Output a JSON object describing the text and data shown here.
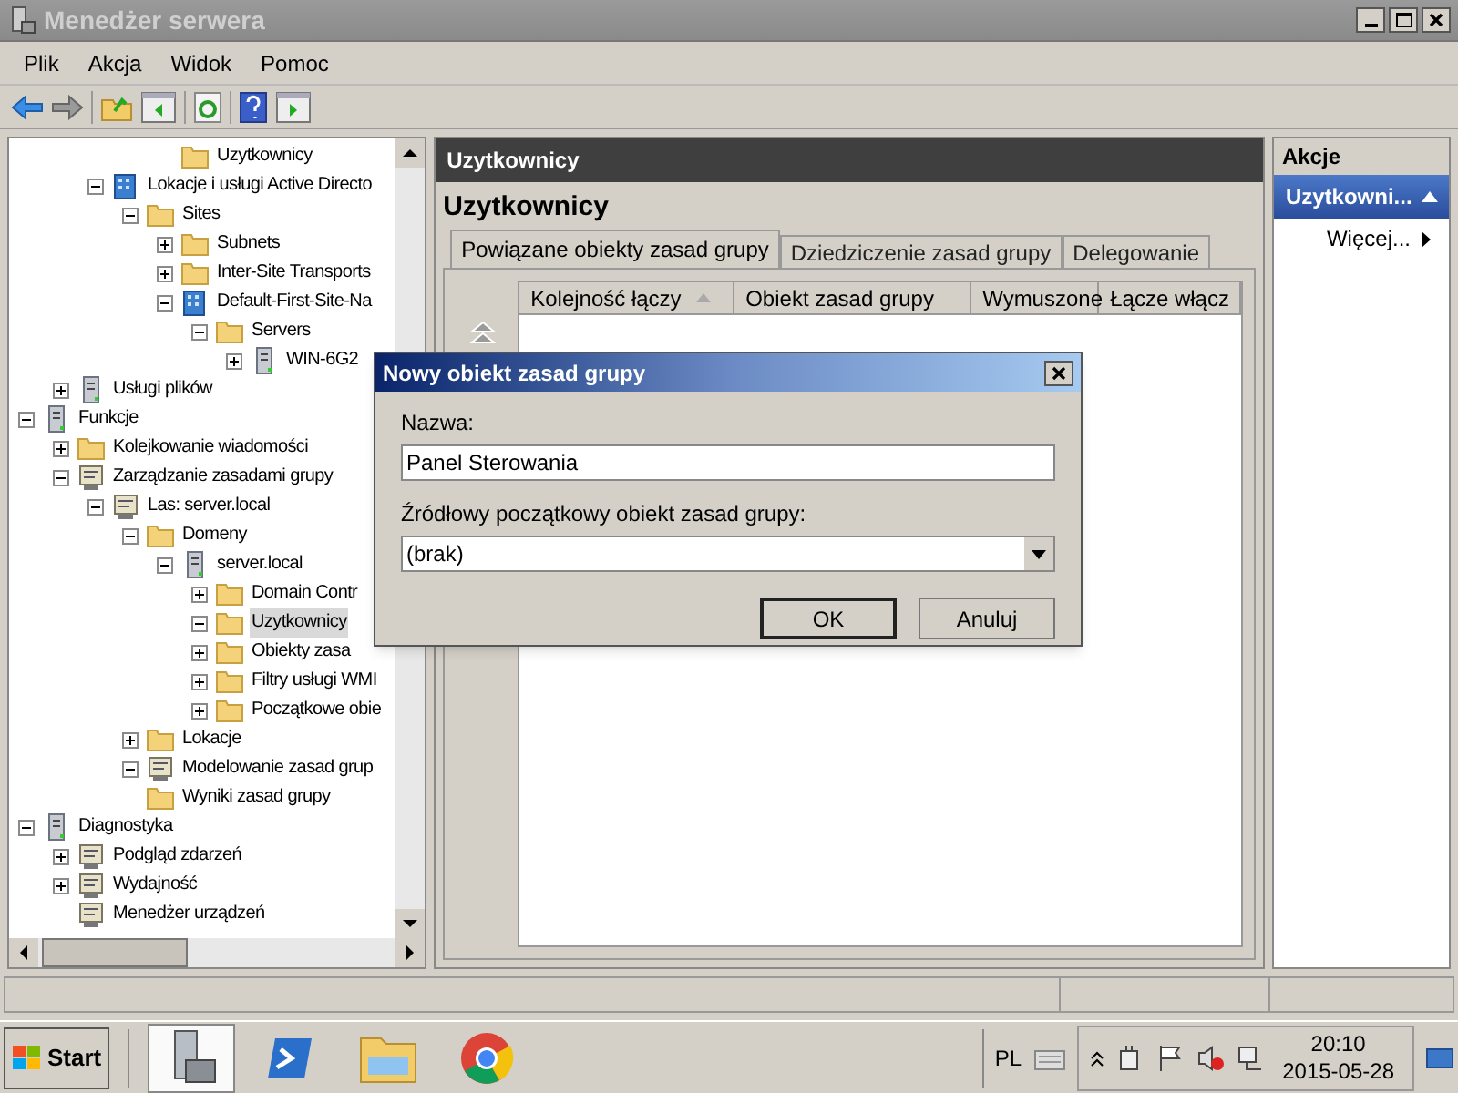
{
  "window": {
    "title": "Menedżer serwera"
  },
  "menu": [
    "Plik",
    "Akcja",
    "Widok",
    "Pomoc"
  ],
  "tree": [
    {
      "children": [
        {
          "children": [
            {
              "children": [
                {
                  "children": [
                    {
                      "label": "Uzytkownicy",
                      "kind": "folder",
                      "selected": false
                    }
                  ]
                }
              ]
            },
            {
              "label": "Lokacje i usługi Active Directo",
              "kind": "site",
              "expanded": true,
              "selected": false,
              "children": [
                {
                  "label": "Sites",
                  "kind": "folder",
                  "expanded": true,
                  "selected": false,
                  "children": [
                    {
                      "label": "Subnets",
                      "kind": "folder",
                      "expanded": false,
                      "selected": false
                    },
                    {
                      "label": "Inter-Site Transports",
                      "kind": "folder",
                      "expanded": false,
                      "selected": false
                    },
                    {
                      "label": "Default-First-Site-Na",
                      "kind": "site",
                      "expanded": true,
                      "selected": false,
                      "children": [
                        {
                          "label": "Servers",
                          "kind": "folder",
                          "expanded": true,
                          "selected": false,
                          "children": [
                            {
                              "label": "WIN-6G2",
                              "kind": "server",
                              "expanded": false,
                              "selected": false
                            }
                          ]
                        }
                      ]
                    }
                  ]
                }
              ]
            }
          ]
        },
        {
          "label": "Usługi plików",
          "kind": "server",
          "expanded": false,
          "selected": false
        }
      ]
    },
    {
      "label": "Funkcje",
      "kind": "server",
      "expanded": true,
      "selected": false,
      "children": [
        {
          "label": "Kolejkowanie wiadomości",
          "kind": "folder",
          "expanded": false,
          "selected": false
        },
        {
          "label": "Zarządzanie zasadami grupy",
          "kind": "tool",
          "expanded": true,
          "selected": false,
          "children": [
            {
              "label": "Las: server.local",
              "kind": "tool",
              "expanded": true,
              "selected": false,
              "children": [
                {
                  "label": "Domeny",
                  "kind": "folder",
                  "expanded": true,
                  "selected": false,
                  "children": [
                    {
                      "label": "server.local",
                      "kind": "server",
                      "expanded": true,
                      "selected": false,
                      "children": [
                        {
                          "label": "Domain Contr",
                          "kind": "folder",
                          "expanded": false,
                          "selected": false
                        },
                        {
                          "label": "Uzytkownicy",
                          "kind": "folder",
                          "expanded": true,
                          "selected": true
                        },
                        {
                          "label": "Obiekty zasa",
                          "kind": "folder",
                          "expanded": false,
                          "selected": false
                        },
                        {
                          "label": "Filtry usługi WMI",
                          "kind": "folder",
                          "expanded": false,
                          "selected": false
                        },
                        {
                          "label": "Początkowe obie",
                          "kind": "folder",
                          "expanded": false,
                          "selected": false
                        }
                      ]
                    }
                  ]
                },
                {
                  "label": "Lokacje",
                  "kind": "folder",
                  "expanded": false,
                  "selected": false
                },
                {
                  "label": "Modelowanie zasad grup",
                  "kind": "tool",
                  "expanded": true,
                  "selected": false
                },
                {
                  "label": "Wyniki zasad grupy",
                  "kind": "folder",
                  "selected": false
                }
              ]
            }
          ]
        }
      ]
    },
    {
      "label": "Diagnostyka",
      "kind": "server",
      "expanded": true,
      "selected": false,
      "children": [
        {
          "label": "Podgląd zdarzeń",
          "kind": "tool",
          "expanded": false,
          "selected": false
        },
        {
          "label": "Wydajność",
          "kind": "tool",
          "expanded": false,
          "selected": false
        },
        {
          "label": "Menedżer urządzeń",
          "kind": "tool",
          "selected": false
        }
      ]
    }
  ],
  "center": {
    "header": "Uzytkownicy",
    "title": "Uzytkownicy",
    "tabs": [
      {
        "label": "Powiązane obiekty zasad grupy",
        "selected": true
      },
      {
        "label": "Dziedziczenie zasad grupy",
        "selected": false
      },
      {
        "label": "Delegowanie",
        "selected": false
      }
    ],
    "columns": [
      "Kolejność łączy",
      "Obiekt zasad grupy",
      "Wymuszone",
      "Łącze włącz"
    ]
  },
  "actions": {
    "title": "Akcje",
    "section": "Uzytkowni...",
    "items": [
      "Więcej..."
    ]
  },
  "dialog": {
    "title": "Nowy obiekt zasad grupy",
    "name_label": "Nazwa:",
    "name_value": "Panel Sterowania",
    "source_label": "Źródłowy początkowy obiekt zasad grupy:",
    "source_value": "(brak)",
    "buttons": [
      "OK",
      "Anuluj"
    ]
  },
  "taskbar": {
    "start": "Start",
    "apps": [
      {
        "kind": "server",
        "selected": true
      },
      {
        "kind": "shell",
        "selected": false
      },
      {
        "kind": "explorer",
        "selected": false
      },
      {
        "kind": "browser",
        "selected": false
      }
    ],
    "language": "PL",
    "time": "20:10",
    "date": "2015-05-28"
  }
}
